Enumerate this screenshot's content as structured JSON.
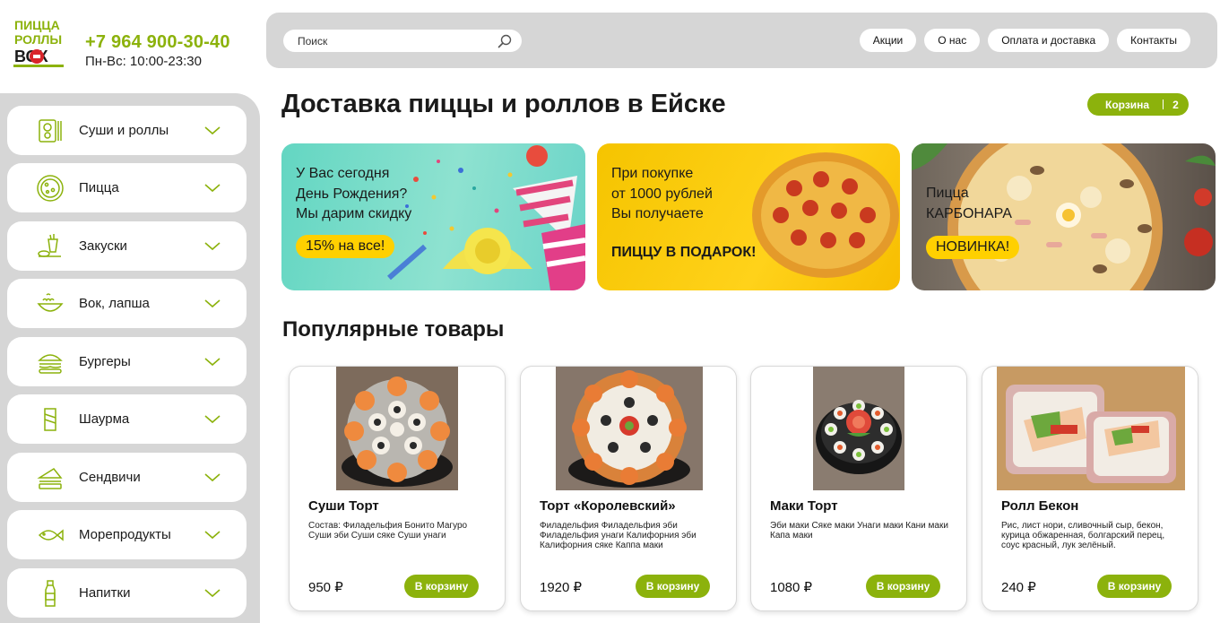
{
  "logo": {
    "line1": "ПИЦЦА",
    "line2": "РОЛЛЫ",
    "line3": "ВОК"
  },
  "contact": {
    "phone": "+7 964 900-30-40",
    "hours": "Пн-Вс: 10:00-23:30"
  },
  "search": {
    "placeholder": "Поиск"
  },
  "nav": [
    "Акции",
    "О нас",
    "Оплата и доставка",
    "Контакты"
  ],
  "sidebar": {
    "items": [
      {
        "label": "Суши и роллы",
        "icon": "sushi-icon"
      },
      {
        "label": "Пицца",
        "icon": "pizza-icon"
      },
      {
        "label": "Закуски",
        "icon": "snacks-icon"
      },
      {
        "label": "Вок, лапша",
        "icon": "wok-icon"
      },
      {
        "label": "Бургеры",
        "icon": "burger-icon"
      },
      {
        "label": "Шаурма",
        "icon": "shawarma-icon"
      },
      {
        "label": "Сендвичи",
        "icon": "sandwich-icon"
      },
      {
        "label": "Морепродукты",
        "icon": "fish-icon"
      },
      {
        "label": "Напитки",
        "icon": "bottle-icon"
      }
    ]
  },
  "page": {
    "title": "Доставка пиццы и роллов в Ейске"
  },
  "cart": {
    "label": "Корзина",
    "count": "2"
  },
  "banners": [
    {
      "lines": [
        "У Вас сегодня",
        "День Рождения?",
        "Мы дарим скидку"
      ],
      "badge": "15% на все!"
    },
    {
      "lines": [
        "При покупке",
        "от 1000 рублей",
        "Вы получаете"
      ],
      "highlight": "ПИЦЦУ В ПОДАРОК!"
    },
    {
      "lines": [
        "Пицца",
        "КАРБОНАРА"
      ],
      "badge": "НОВИНКА!"
    }
  ],
  "popular": {
    "title": "Популярные товары",
    "button_label": "В корзину",
    "products": [
      {
        "name": "Суши Торт",
        "description": "Состав: Филадельфия Бонито Магуро Суши эби Суши сяке Суши унаги",
        "price": "950 ₽"
      },
      {
        "name": "Торт «Королевский»",
        "description": "Филадельфия Филадельфия эби Филадельфия унаги Калифорния эби Калифорния сяке Каппа маки",
        "price": "1920 ₽"
      },
      {
        "name": "Маки Торт",
        "description": "Эби маки Сяке маки Унаги маки Кани маки Капа маки",
        "price": "1080 ₽"
      },
      {
        "name": "Ролл Бекон",
        "description": "Рис, лист нори, сливочный сыр, бекон, курица обжаренная, болгарский перец, соус красный, лук зелёный.",
        "price": "240 ₽"
      }
    ]
  },
  "colors": {
    "accent": "#8cb20c",
    "panel": "#d6d6d6",
    "badge": "#ffd000"
  }
}
